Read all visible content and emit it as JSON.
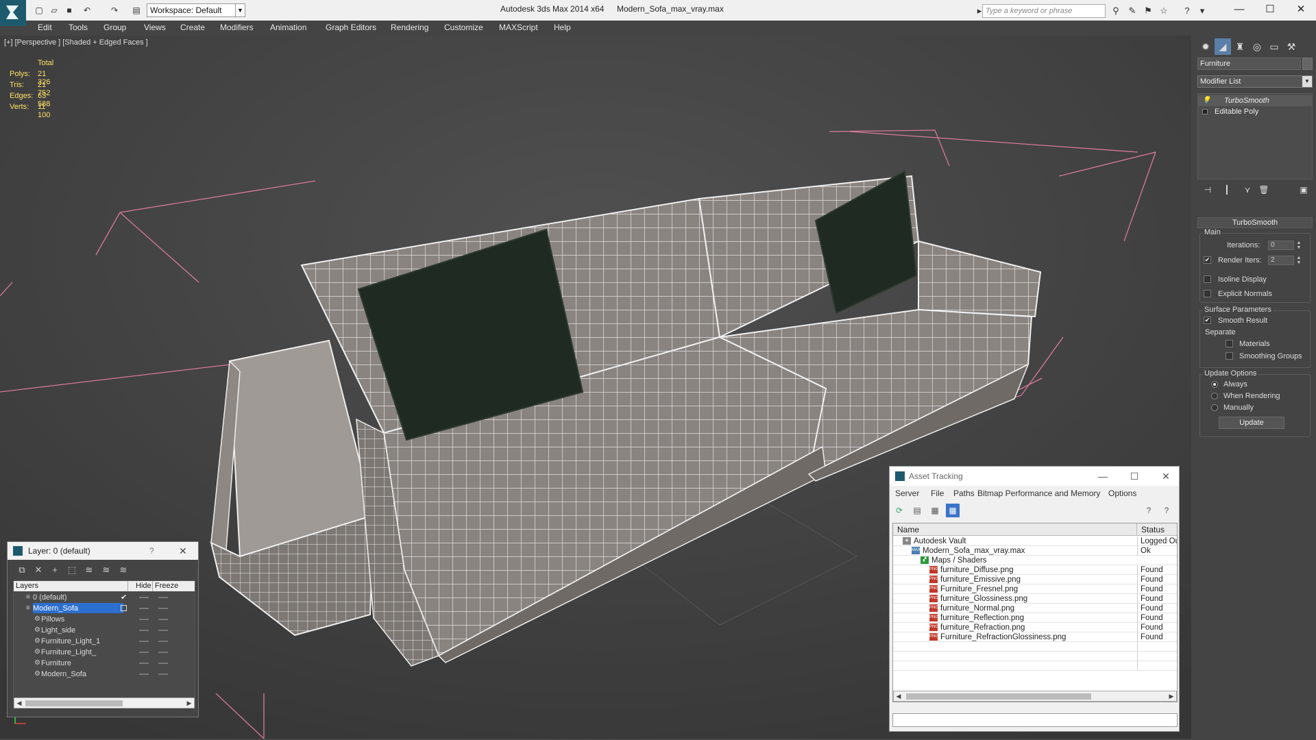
{
  "app": {
    "title": "Autodesk 3ds Max  2014 x64",
    "file": "Modern_Sofa_max_vray.max",
    "workspace": "Workspace: Default",
    "search_placeholder": "Type a keyword or phrase"
  },
  "menu": [
    "Edit",
    "Tools",
    "Group",
    "Views",
    "Create",
    "Modifiers",
    "Animation",
    "Graph Editors",
    "Rendering",
    "Customize",
    "MAXScript",
    "Help"
  ],
  "viewport": {
    "label": "[+] [Perspective ] [Shaded + Edged Faces ]",
    "stats_header": "Total",
    "stats": [
      {
        "label": "Polys:",
        "value": "21 326"
      },
      {
        "label": "Tris:",
        "value": "21 752"
      },
      {
        "label": "Edges:",
        "value": "63 588"
      },
      {
        "label": "Verts:",
        "value": "11 100"
      }
    ]
  },
  "command_panel": {
    "object_name": "Furniture",
    "modifier_list": "Modifier List",
    "stack": [
      "TurboSmooth",
      "Editable Poly"
    ],
    "rollout_title": "TurboSmooth",
    "main_group": "Main",
    "iterations_label": "Iterations:",
    "iterations_value": "0",
    "render_iters_label": "Render Iters:",
    "render_iters_value": "2",
    "render_iters_checked": true,
    "isoline_label": "Isoline Display",
    "explicit_normals_label": "Explicit Normals",
    "surface_group": "Surface Parameters",
    "smooth_result_label": "Smooth Result",
    "separate_label": "Separate",
    "materials_label": "Materials",
    "smoothing_groups_label": "Smoothing Groups",
    "update_group": "Update Options",
    "update_options": [
      "Always",
      "When Rendering",
      "Manually"
    ],
    "update_selected": "Always",
    "update_button": "Update"
  },
  "layer_window": {
    "title": "Layer: 0 (default)",
    "help": "?",
    "columns": [
      "Layers",
      "Hide",
      "Freeze"
    ],
    "rows": [
      {
        "name": "0 (default)",
        "level": 1,
        "selected": false
      },
      {
        "name": "Modern_Sofa",
        "level": 1,
        "selected": true
      },
      {
        "name": "Pillows",
        "level": 2,
        "selected": false
      },
      {
        "name": "Light_side",
        "level": 2,
        "selected": false
      },
      {
        "name": "Furniture_Light_1",
        "level": 2,
        "selected": false
      },
      {
        "name": "Furniture_Light_",
        "level": 2,
        "selected": false
      },
      {
        "name": "Furniture",
        "level": 2,
        "selected": false
      },
      {
        "name": "Modern_Sofa",
        "level": 2,
        "selected": false
      }
    ]
  },
  "asset_window": {
    "title": "Asset Tracking",
    "menu": [
      "Server",
      "File",
      "Paths",
      "Bitmap Performance and Memory",
      "Options"
    ],
    "columns": [
      "Name",
      "Status"
    ],
    "rows": [
      {
        "name": "Autodesk Vault",
        "status": "Logged Ou",
        "level": 1,
        "icon": "vault"
      },
      {
        "name": "Modern_Sofa_max_vray.max",
        "status": "Ok",
        "level": 2,
        "icon": "max"
      },
      {
        "name": "Maps / Shaders",
        "status": "",
        "level": 3,
        "icon": "maps"
      },
      {
        "name": "furniture_Diffuse.png",
        "status": "Found",
        "level": 4,
        "icon": "png"
      },
      {
        "name": "furniture_Emissive.png",
        "status": "Found",
        "level": 4,
        "icon": "png"
      },
      {
        "name": "Furniture_Fresnel.png",
        "status": "Found",
        "level": 4,
        "icon": "png"
      },
      {
        "name": "furniture_Glossiness.png",
        "status": "Found",
        "level": 4,
        "icon": "png"
      },
      {
        "name": "furniture_Normal.png",
        "status": "Found",
        "level": 4,
        "icon": "png"
      },
      {
        "name": "furniture_Reflection.png",
        "status": "Found",
        "level": 4,
        "icon": "png"
      },
      {
        "name": "furniture_Refraction.png",
        "status": "Found",
        "level": 4,
        "icon": "png"
      },
      {
        "name": "Furniture_RefractionGlossiness.png",
        "status": "Found",
        "level": 4,
        "icon": "png"
      }
    ]
  },
  "colors": {
    "viewport_bg": "#3d3d3d",
    "stats_text": "#ffe066",
    "selection": "#2d6fcf",
    "pillow": "#1f2a22",
    "bounding_box": "#d87a9a"
  }
}
